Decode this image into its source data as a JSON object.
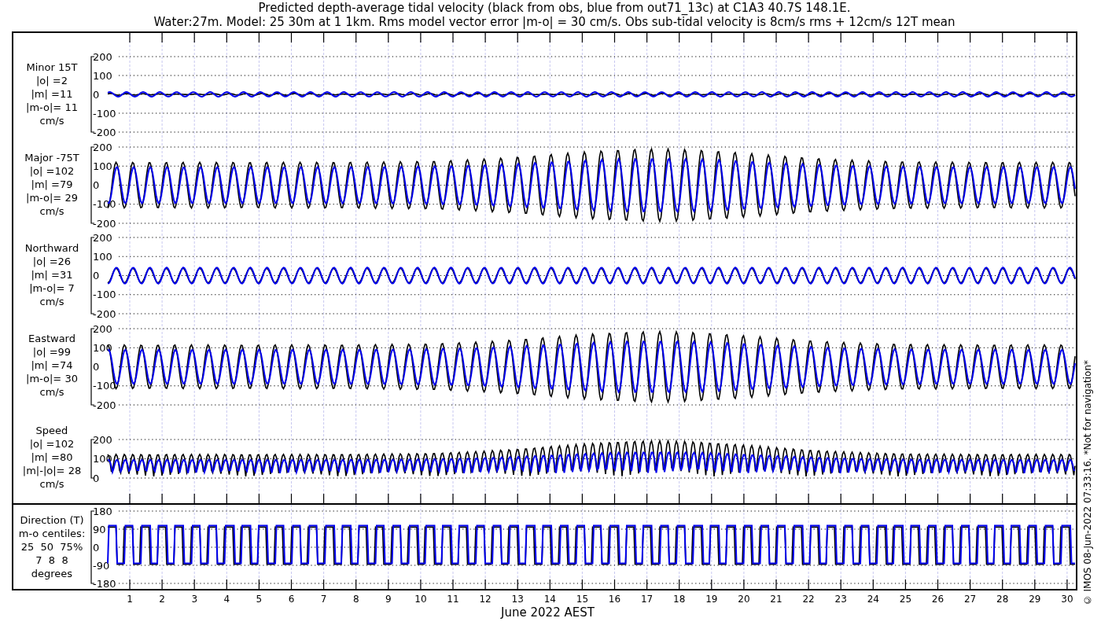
{
  "title_lines": [
    "Predicted depth-average tidal velocity (black from obs, blue from out71_13c) at C1A3 40.7S 148.1E.",
    "Water:27m. Model: 25 30m at 1 1km. Rms model vector error |m-o| = 30 cm/s. Obs sub-tidal velocity is 8cm/s rms + 12cm/s 12T mean"
  ],
  "panels": [
    {
      "kind": "minor",
      "label_lines": [
        "Minor 15T",
        "|o| =2",
        "|m| =11",
        "|m-o|= 11",
        "cm/s"
      ],
      "yticks": [
        "200",
        "100",
        "0",
        "-100",
        "-200"
      ]
    },
    {
      "kind": "major",
      "label_lines": [
        "Major -75T",
        "|o| =102",
        "|m| =79",
        "|m-o|= 29",
        "cm/s"
      ],
      "yticks": [
        "200",
        "100",
        "0",
        "-100",
        "-200"
      ]
    },
    {
      "kind": "north",
      "label_lines": [
        "Northward",
        "|o| =26",
        "|m| =31",
        "|m-o|= 7",
        "cm/s"
      ],
      "yticks": [
        "200",
        "100",
        "0",
        "-100",
        "-200"
      ]
    },
    {
      "kind": "east",
      "label_lines": [
        "Eastward",
        "|o| =99",
        "|m| =74",
        "|m-o|= 30",
        "cm/s"
      ],
      "yticks": [
        "200",
        "100",
        "0",
        "-100",
        "-200"
      ]
    },
    {
      "kind": "speed",
      "label_lines": [
        "Speed",
        "|o| =102",
        "|m| =80",
        "|m|-|o|= 28",
        "cm/s"
      ],
      "yticks": [
        "200",
        "100",
        "0"
      ]
    },
    {
      "kind": "direction",
      "label_lines": [
        "Direction (T)",
        "m-o centiles:",
        "25  50  75%",
        "7  8  8",
        "degrees"
      ],
      "yticks": [
        "180",
        "90",
        "0",
        "-90",
        "-180"
      ]
    }
  ],
  "xticks": [
    "1",
    "2",
    "3",
    "4",
    "5",
    "6",
    "7",
    "8",
    "9",
    "10",
    "11",
    "12",
    "13",
    "14",
    "15",
    "16",
    "17",
    "18",
    "19",
    "20",
    "21",
    "22",
    "23",
    "24",
    "25",
    "26",
    "27",
    "28",
    "29",
    "30"
  ],
  "xlabel": "June 2022 AEST",
  "stamp": "© IMOS 08-Jun-2022 07:33:16. *Not for navigation*"
}
